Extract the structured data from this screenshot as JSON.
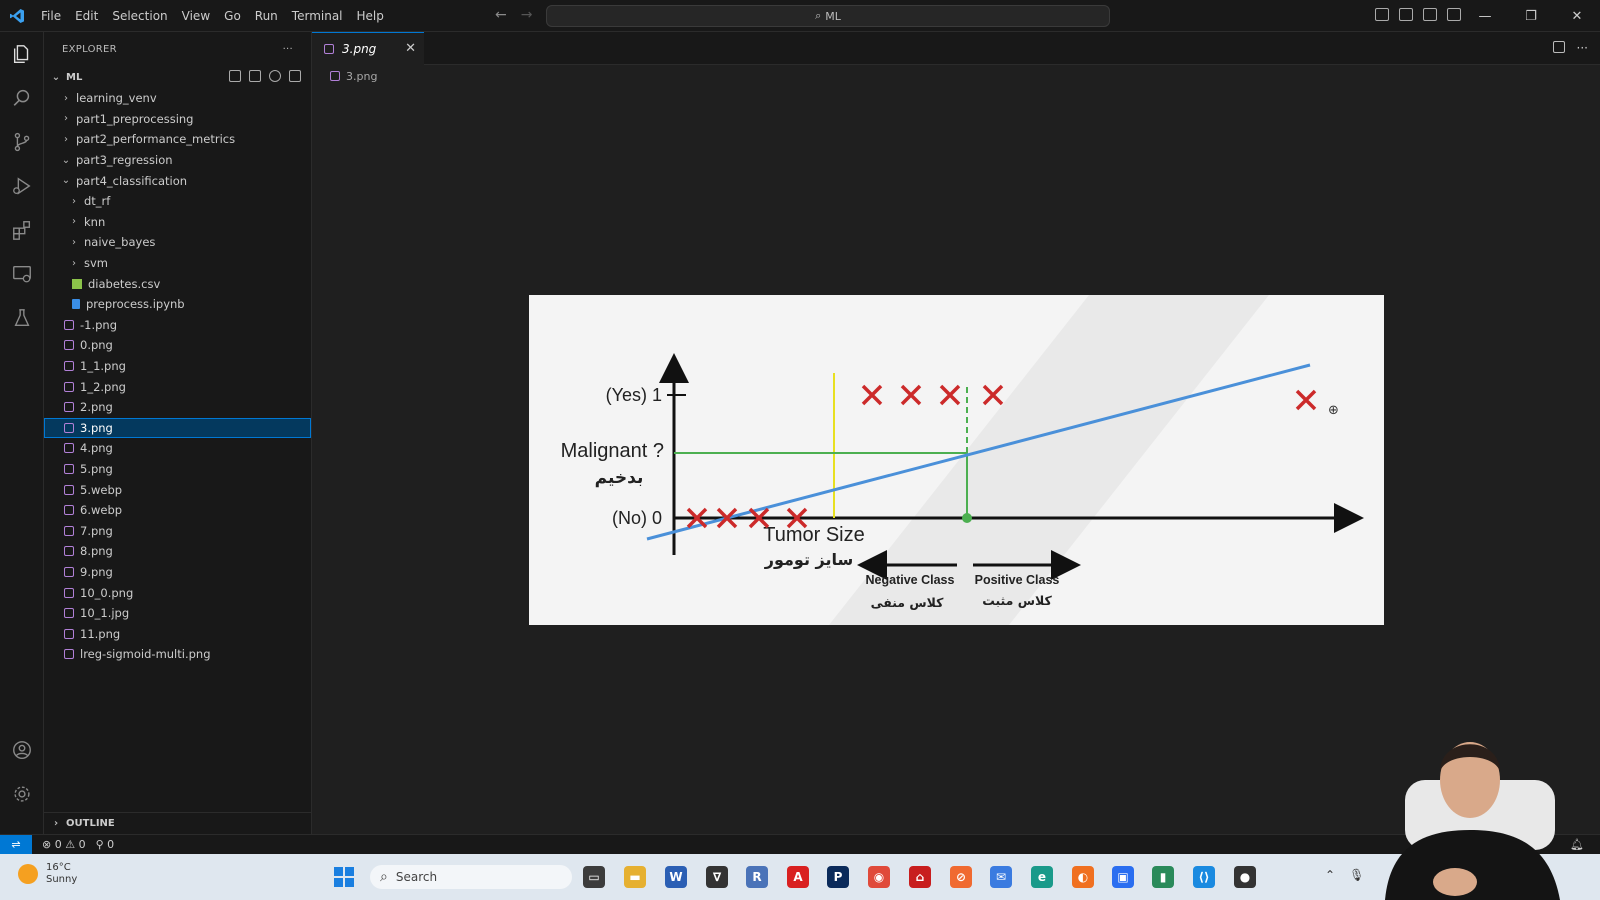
{
  "titlebar": {
    "menu": [
      "File",
      "Edit",
      "Selection",
      "View",
      "Go",
      "Run",
      "Terminal",
      "Help"
    ],
    "search_text": "ML"
  },
  "explorer": {
    "title": "EXPLORER",
    "more": "···",
    "root": "ML",
    "items": [
      {
        "label": "learning_venv",
        "type": "folder",
        "depth": 1,
        "expanded": false
      },
      {
        "label": "part1_preprocessing",
        "type": "folder",
        "depth": 1,
        "expanded": false
      },
      {
        "label": "part2_performance_metrics",
        "type": "folder",
        "depth": 1,
        "expanded": false
      },
      {
        "label": "part3_regression",
        "type": "folder",
        "depth": 1,
        "expanded": true
      },
      {
        "label": "part4_classification",
        "type": "folder",
        "depth": 1,
        "expanded": true
      },
      {
        "label": "dt_rf",
        "type": "folder",
        "depth": 2,
        "expanded": false
      },
      {
        "label": "knn",
        "type": "folder",
        "depth": 2,
        "expanded": false
      },
      {
        "label": "naive_bayes",
        "type": "folder",
        "depth": 2,
        "expanded": false
      },
      {
        "label": "svm",
        "type": "folder",
        "depth": 2,
        "expanded": false
      },
      {
        "label": "diabetes.csv",
        "type": "csv",
        "depth": 2
      },
      {
        "label": "preprocess.ipynb",
        "type": "ipynb",
        "depth": 2
      },
      {
        "label": "-1.png",
        "type": "img",
        "depth": 1
      },
      {
        "label": "0.png",
        "type": "img",
        "depth": 1
      },
      {
        "label": "1_1.png",
        "type": "img",
        "depth": 1
      },
      {
        "label": "1_2.png",
        "type": "img",
        "depth": 1
      },
      {
        "label": "2.png",
        "type": "img",
        "depth": 1
      },
      {
        "label": "3.png",
        "type": "img",
        "depth": 1,
        "selected": true
      },
      {
        "label": "4.png",
        "type": "img",
        "depth": 1
      },
      {
        "label": "5.png",
        "type": "img",
        "depth": 1
      },
      {
        "label": "5.webp",
        "type": "img",
        "depth": 1
      },
      {
        "label": "6.webp",
        "type": "img",
        "depth": 1
      },
      {
        "label": "7.png",
        "type": "img",
        "depth": 1
      },
      {
        "label": "8.png",
        "type": "img",
        "depth": 1
      },
      {
        "label": "9.png",
        "type": "img",
        "depth": 1
      },
      {
        "label": "10_0.png",
        "type": "img",
        "depth": 1
      },
      {
        "label": "10_1.jpg",
        "type": "img",
        "depth": 1
      },
      {
        "label": "11.png",
        "type": "img",
        "depth": 1
      },
      {
        "label": "lreg-sigmoid-multi.png",
        "type": "img",
        "depth": 1
      }
    ],
    "outline_label": "OUTLINE"
  },
  "editor": {
    "tab_label": "3.png",
    "tab_close": "✕",
    "breadcrumb": "3.png"
  },
  "figure": {
    "y_label_yes": "(Yes) 1",
    "y_label_no": "(No) 0",
    "question_en": "Malignant ?",
    "question_fa": "بدخیم",
    "x_label_en": "Tumor Size",
    "x_label_fa": "سایز تومور",
    "neg_class_en": "Negative Class",
    "neg_class_fa": "کلاس منفی",
    "pos_class_en": "Positive Class",
    "pos_class_fa": "کلاس مثبت",
    "marker_color": "#cc2a2a",
    "line_color": "#4a90d9",
    "threshold_color": "#4caf50",
    "vertical_color": "#e8e020",
    "negative_points": 4,
    "positive_points": 5
  },
  "statusbar": {
    "errors": "0",
    "warnings": "0",
    "ports": "0"
  },
  "taskbar": {
    "temperature": "16°C",
    "weather": "Sunny",
    "search_placeholder": "Search"
  }
}
